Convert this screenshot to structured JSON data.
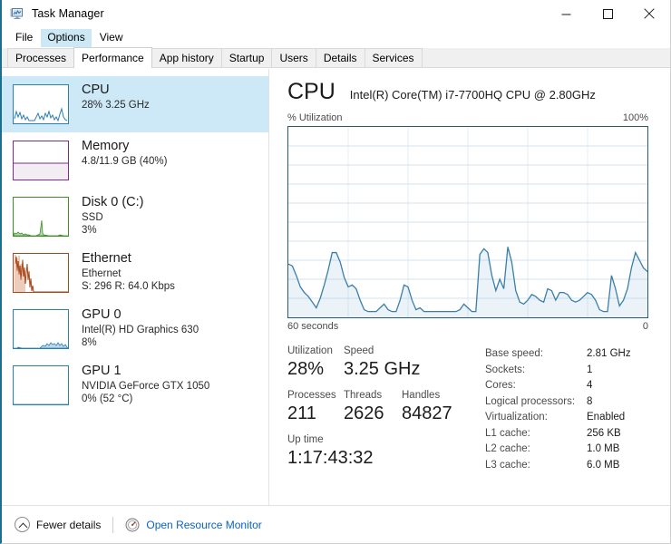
{
  "window": {
    "title": "Task Manager",
    "icon": "task-manager-icon",
    "minimize_label": "—",
    "maximize_label": "□",
    "close_label": "✕"
  },
  "menubar": {
    "items": [
      {
        "label": "File",
        "highlighted": false
      },
      {
        "label": "Options",
        "highlighted": true
      },
      {
        "label": "View",
        "highlighted": false
      }
    ]
  },
  "tabs": {
    "items": [
      {
        "label": "Processes",
        "active": false
      },
      {
        "label": "Performance",
        "active": true
      },
      {
        "label": "App history",
        "active": false
      },
      {
        "label": "Startup",
        "active": false
      },
      {
        "label": "Users",
        "active": false
      },
      {
        "label": "Details",
        "active": false
      },
      {
        "label": "Services",
        "active": false
      }
    ]
  },
  "sidebar": {
    "items": [
      {
        "name": "CPU",
        "line2": "28%  3.25 GHz",
        "line3": "",
        "selected": true,
        "color": "#2a7fb5",
        "fill": "rgba(42,127,181,0.10)",
        "graph": "cpu-sparkline"
      },
      {
        "name": "Memory",
        "line2": "4.8/11.9 GB (40%)",
        "line3": "",
        "selected": false,
        "color": "#7b2d8e",
        "fill": "rgba(123,45,142,0.08)",
        "graph": "memory-bar"
      },
      {
        "name": "Disk 0 (C:)",
        "line2": "SSD",
        "line3": "3%",
        "selected": false,
        "color": "#3f8f29",
        "fill": "rgba(63,143,41,0.10)",
        "graph": "disk-sparkline"
      },
      {
        "name": "Ethernet",
        "line2": "Ethernet",
        "line3": "S: 296  R: 64.0 Kbps",
        "selected": false,
        "color": "#a8481a",
        "fill": "rgba(168,72,26,0.12)",
        "graph": "ethernet-sparkline"
      },
      {
        "name": "GPU 0",
        "line2": "Intel(R) HD Graphics 630",
        "line3": "8%",
        "selected": false,
        "color": "#2a7fb5",
        "fill": "rgba(42,127,181,0.10)",
        "graph": "gpu0-sparkline"
      },
      {
        "name": "GPU 1",
        "line2": "NVIDIA GeForce GTX 1050",
        "line3": "0%  (52 °C)",
        "selected": false,
        "color": "#2a7fb5",
        "fill": "rgba(42,127,181,0.10)",
        "graph": "gpu1-sparkline"
      }
    ]
  },
  "main": {
    "heading": "CPU",
    "model": "Intel(R) Core(TM) i7-7700HQ CPU @ 2.80GHz",
    "graph_axis_top_left": "% Utilization",
    "graph_axis_top_right": "100%",
    "graph_axis_bottom_left": "60 seconds",
    "graph_axis_bottom_right": "0",
    "stats": {
      "utilization_label": "Utilization",
      "utilization_value": "28%",
      "speed_label": "Speed",
      "speed_value": "3.25 GHz",
      "processes_label": "Processes",
      "processes_value": "211",
      "threads_label": "Threads",
      "threads_value": "2626",
      "handles_label": "Handles",
      "handles_value": "84827",
      "uptime_label": "Up time",
      "uptime_value": "1:17:43:32"
    },
    "specs": [
      {
        "label": "Base speed:",
        "value": "2.81 GHz"
      },
      {
        "label": "Sockets:",
        "value": "1"
      },
      {
        "label": "Cores:",
        "value": "4"
      },
      {
        "label": "Logical processors:",
        "value": "8"
      },
      {
        "label": "Virtualization:",
        "value": "Enabled"
      },
      {
        "label": "L1 cache:",
        "value": "256 KB"
      },
      {
        "label": "L2 cache:",
        "value": "1.0 MB"
      },
      {
        "label": "L3 cache:",
        "value": "6.0 MB"
      }
    ]
  },
  "footer": {
    "fewer_details_label": "Fewer details",
    "resource_monitor_label": "Open Resource Monitor",
    "link_color": "#0a61c9"
  },
  "chart_data": {
    "type": "area",
    "title": "CPU % Utilization",
    "xlabel": "60 seconds",
    "ylabel": "% Utilization",
    "ylim": [
      0,
      100
    ],
    "xlim": [
      60,
      0
    ],
    "grid": true,
    "grid_cols": 6,
    "grid_rows": 10,
    "line_color": "#3a7fa8",
    "fill_color": "rgba(130,180,215,0.16)",
    "series": [
      {
        "name": "CPU utilization",
        "values": [
          28,
          27,
          22,
          16,
          13,
          11,
          8,
          5,
          10,
          17,
          25,
          34,
          34,
          29,
          21,
          16,
          17,
          15,
          9,
          4,
          3,
          3,
          3,
          5,
          7,
          4,
          3,
          3,
          9,
          17,
          16,
          9,
          4,
          5,
          3,
          3,
          3,
          3,
          3,
          3,
          3,
          3,
          3,
          4,
          7,
          5,
          3,
          3,
          33,
          36,
          34,
          22,
          14,
          20,
          15,
          37,
          29,
          14,
          8,
          7,
          9,
          12,
          11,
          9,
          8,
          15,
          14,
          9,
          13,
          13,
          12,
          9,
          8,
          9,
          11,
          13,
          12,
          9,
          4,
          3,
          3,
          22,
          15,
          6,
          9,
          15,
          26,
          34,
          30,
          26,
          24
        ]
      }
    ]
  }
}
